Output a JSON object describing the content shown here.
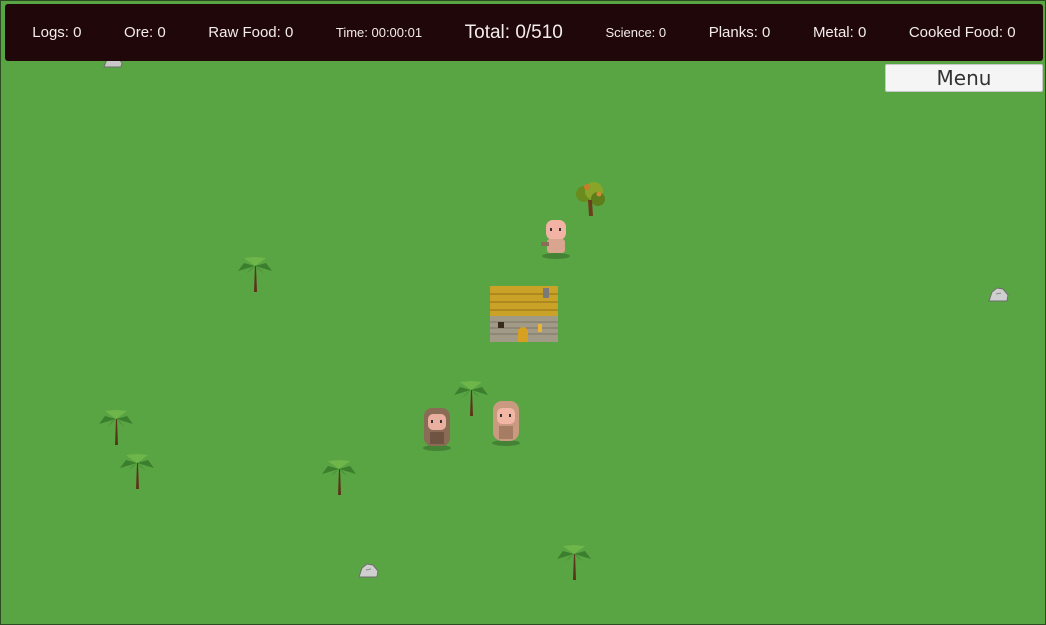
{
  "hud": {
    "logs": "Logs: 0",
    "ore": "Ore: 0",
    "raw_food": "Raw Food: 0",
    "time": "Time: 00:00:01",
    "total": "Total: 0/510",
    "science": "Science: 0",
    "planks": "Planks: 0",
    "metal": "Metal: 0",
    "cooked_food": "Cooked Food: 0"
  },
  "menu": {
    "label": "Menu"
  },
  "colors": {
    "grass": "#5aa543",
    "hud_bg": "#20070a",
    "hud_text": "#f3ecec"
  },
  "icons": [
    "palm-tree-icon",
    "bush-tree-icon",
    "rock-icon",
    "house-icon",
    "villager-icon"
  ]
}
